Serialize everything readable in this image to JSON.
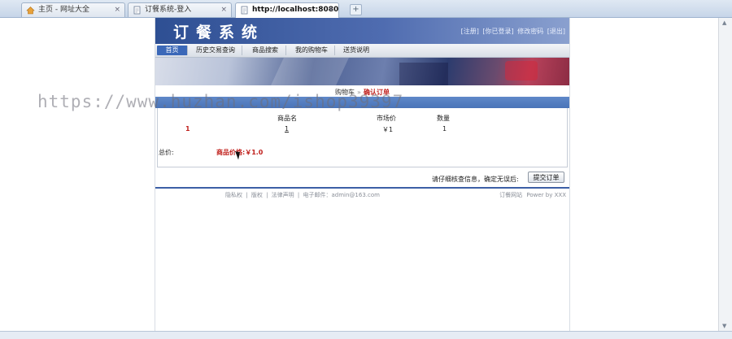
{
  "browser": {
    "tabs": [
      {
        "title": "主页 - 网址大全",
        "active": false
      },
      {
        "title": "订餐系统-登入",
        "active": false
      },
      {
        "title": "http://localhost:8080/...",
        "active": true
      }
    ],
    "close_glyph": "×",
    "new_tab_glyph": "+"
  },
  "site": {
    "logo": "订餐系统",
    "top_links": [
      "[注册]",
      "[你已登录]",
      "修改密码",
      "[退出]"
    ],
    "nav": [
      "首页",
      "历史交易查询",
      "商品搜索",
      "我的购物车",
      "送货说明"
    ],
    "nav_active_index": 0
  },
  "breadcrumb": {
    "parent": "购物车",
    "separator": "»",
    "current": "确认订单"
  },
  "order": {
    "headers": [
      "商品名",
      "市场价",
      "数量"
    ],
    "rows": [
      {
        "index": "1",
        "name": "1",
        "price": "￥1",
        "quantity": "1"
      }
    ],
    "total_label": "总价:",
    "total_value": "商品价格:￥1.0"
  },
  "confirm_text": "请仔细核查信息，确定无误后:",
  "submit_label": "提交订单",
  "footer": {
    "links": [
      "隐私权",
      "|",
      "版权",
      "|",
      "法律声明",
      "|",
      "电子邮件：admin@163.com"
    ],
    "power": [
      "订餐网站",
      "Power by XXX"
    ]
  },
  "watermark": "https://www.huzhan.com/ishop39397",
  "colors": {
    "brand_blue": "#3c5fa6",
    "accent_red": "#c0201c"
  }
}
